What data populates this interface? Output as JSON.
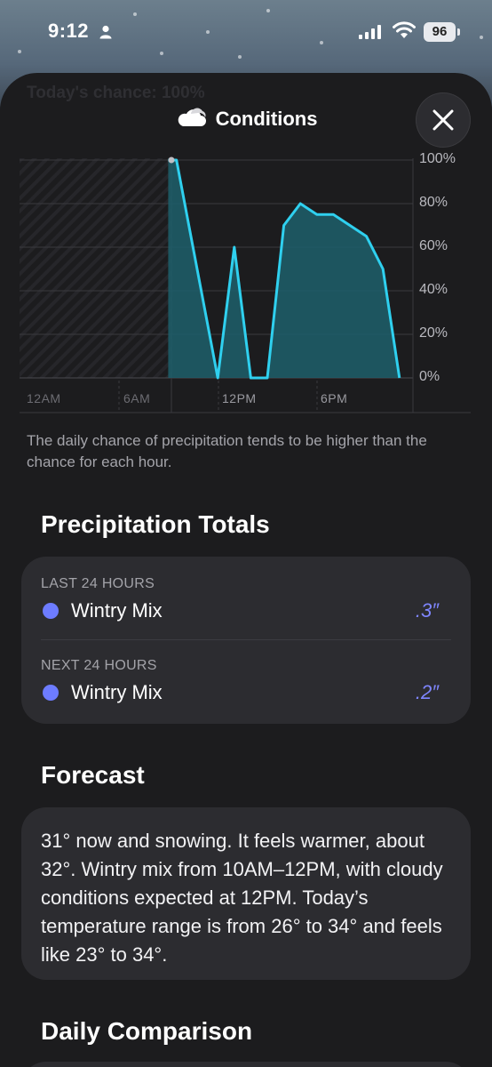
{
  "status_bar": {
    "time": "9:12",
    "battery": "96"
  },
  "sheet": {
    "ghost_text": "Today's chance: 100%",
    "title": "Conditions",
    "title_icon": "cloud-icon",
    "close_icon": "close-icon"
  },
  "chart": {
    "y_ticks": [
      "100%",
      "80%",
      "60%",
      "40%",
      "20%",
      "0%"
    ],
    "x_ticks": [
      "12AM",
      "6AM",
      "12PM",
      "6PM"
    ],
    "note": "The daily chance of precipitation tends to be higher than the chance for each hour."
  },
  "chart_data": {
    "type": "area",
    "ylabel": "",
    "ylim": [
      0,
      100
    ],
    "x_unit": "hour of day",
    "x": [
      9,
      9.5,
      12,
      13,
      14,
      15,
      16,
      17,
      18,
      19,
      20,
      21,
      22,
      23
    ],
    "series": [
      {
        "values": [
          100,
          100,
          0,
          60,
          0,
          0,
          70,
          80,
          75,
          75,
          70,
          65,
          50,
          0
        ]
      }
    ],
    "colors": {
      "line": "#2fd0ef",
      "fill": "#1d5f6b"
    }
  },
  "totals": {
    "heading": "Precipitation Totals",
    "rows": [
      {
        "label": "LAST 24 HOURS",
        "name": "Wintry Mix",
        "value": ".3″"
      },
      {
        "label": "NEXT 24 HOURS",
        "name": "Wintry Mix",
        "value": ".2″"
      }
    ],
    "dot_color": "#6d7cff"
  },
  "forecast": {
    "heading": "Forecast",
    "text": "31° now and snowing. It feels warmer, about 32°. Wintry mix from 10AM–12PM, with cloudy conditions expected at 12PM. Today’s temperature range is from 26° to 34° and feels like 23° to 34°."
  },
  "daily": {
    "heading": "Daily Comparison"
  }
}
